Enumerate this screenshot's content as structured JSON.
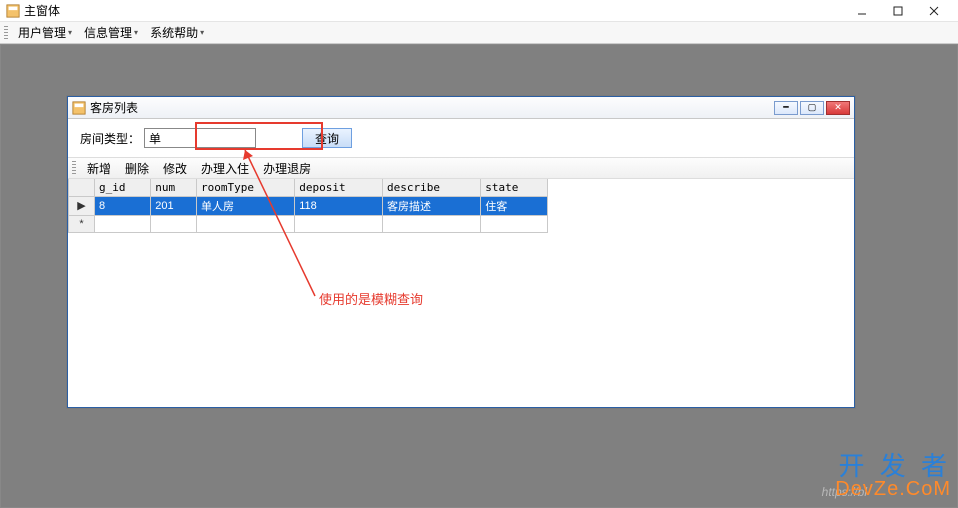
{
  "main": {
    "title": "主窗体",
    "menus": [
      "用户管理",
      "信息管理",
      "系统帮助"
    ]
  },
  "child": {
    "title": "客房列表",
    "search_label": "房间类型：",
    "search_value": "单",
    "query_button": "查询",
    "toolbar": [
      "新增",
      "删除",
      "修改",
      "办理入住",
      "办理退房"
    ]
  },
  "grid": {
    "columns": [
      "g_id",
      "num",
      "roomType",
      "deposit",
      "describe",
      "state"
    ],
    "rows": [
      {
        "selected": true,
        "marker": "▶",
        "cells": [
          "8",
          "201",
          "单人房",
          "118",
          "客房描述",
          "住客"
        ]
      },
      {
        "selected": false,
        "marker": "*",
        "cells": [
          "",
          "",
          "",
          "",
          "",
          ""
        ]
      }
    ]
  },
  "annotation": "使用的是模糊查询",
  "watermark": {
    "line1": "开 发 者",
    "line2": "DevZe.CoM",
    "url": "https://bl"
  }
}
